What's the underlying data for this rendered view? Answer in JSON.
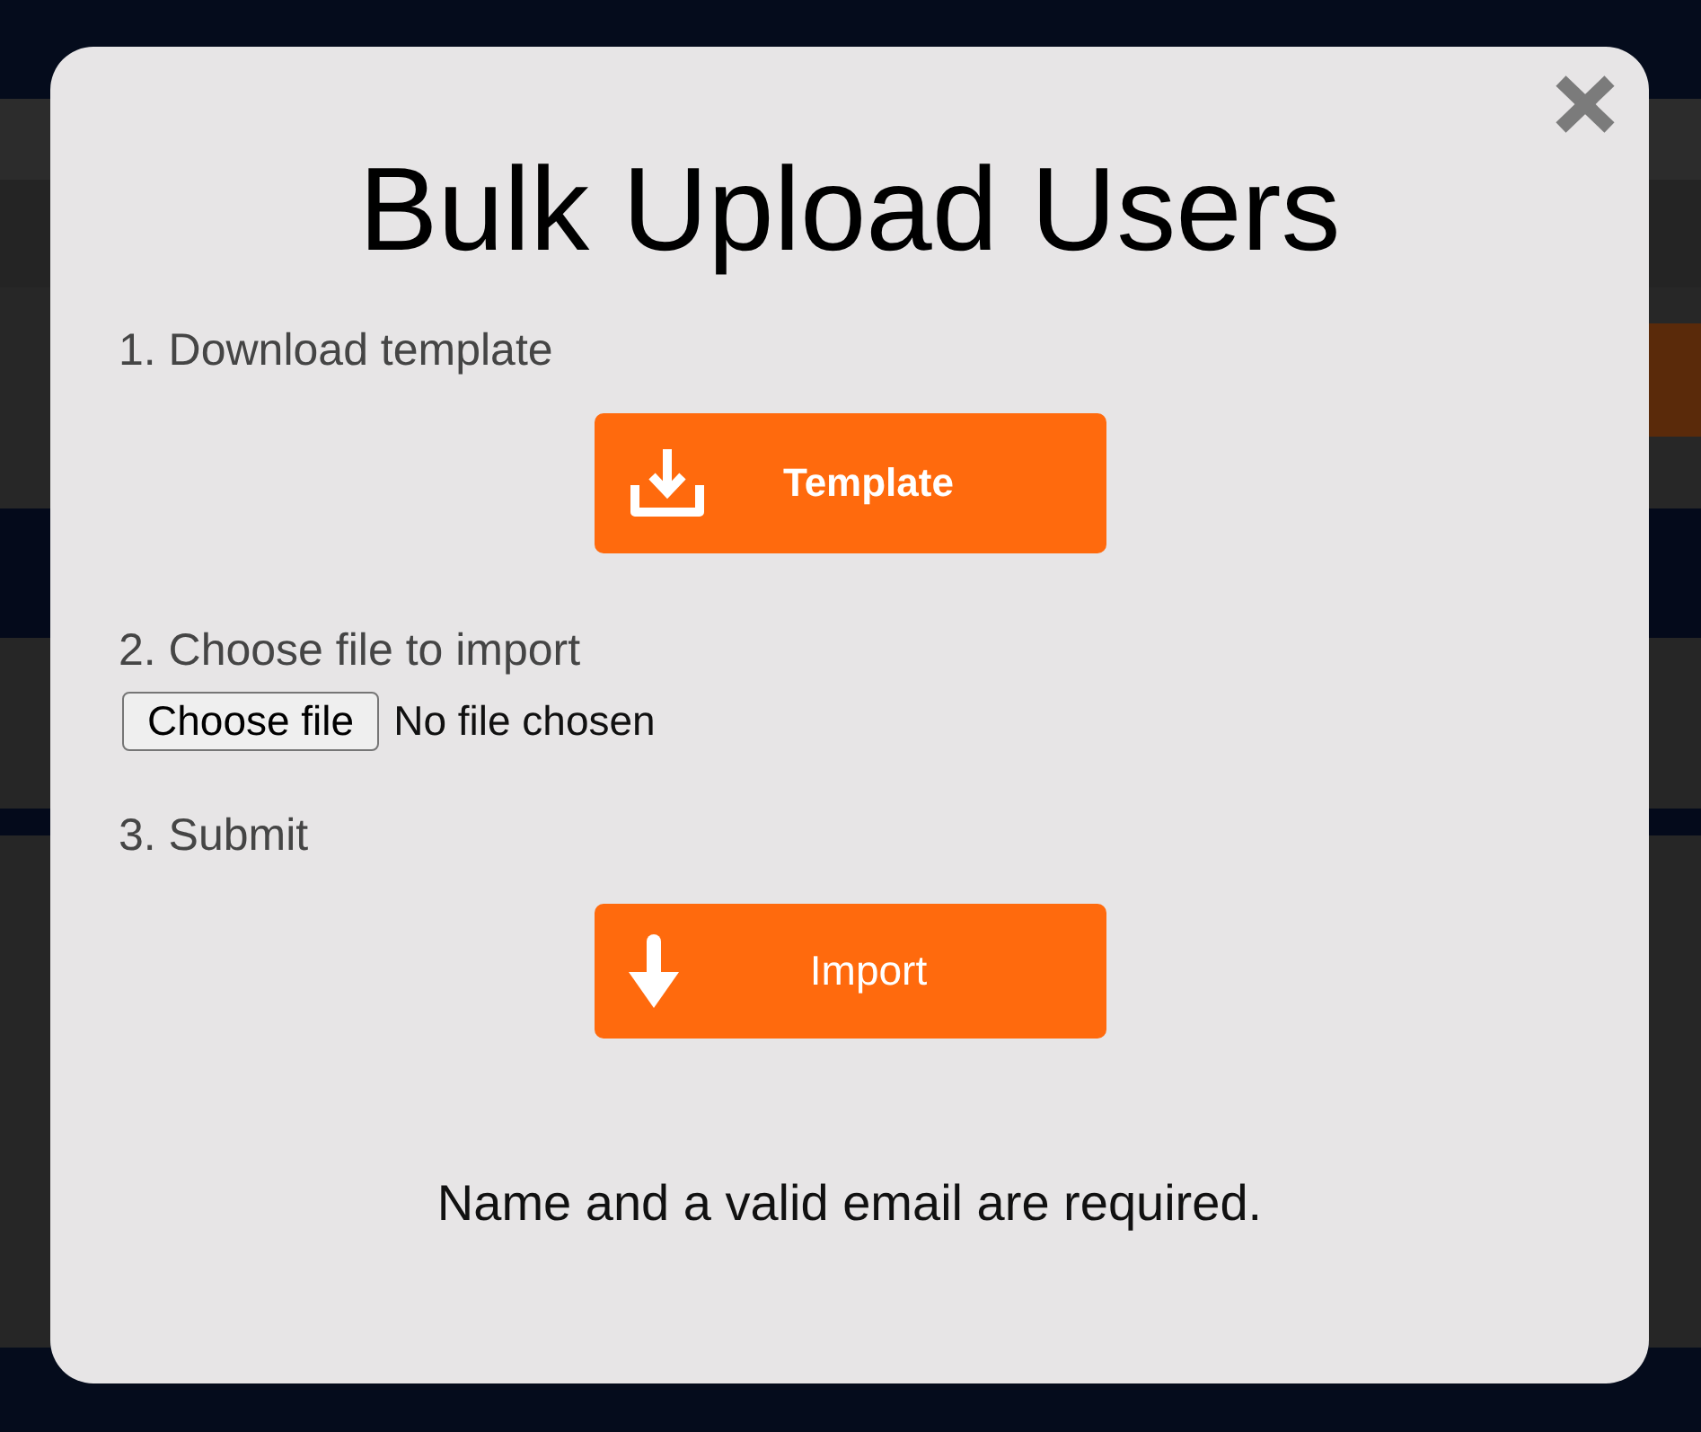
{
  "dialog": {
    "title": "Bulk Upload Users"
  },
  "steps": [
    {
      "kind": "download",
      "label": "1. Download template",
      "button": "Template"
    },
    {
      "kind": "file",
      "label": "2. Choose file to import",
      "button": "Choose file",
      "status": "No file chosen"
    },
    {
      "kind": "submit",
      "label": "3. Submit",
      "button": "Import"
    }
  ],
  "message": "Name and a valid email are required."
}
